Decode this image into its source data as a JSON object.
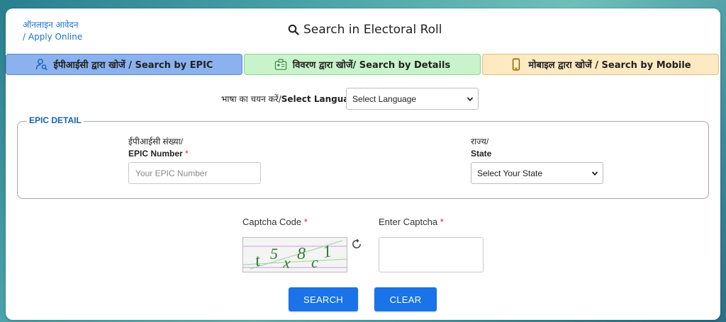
{
  "apply_online": {
    "line1": "ऑनलाइन आवेदन",
    "line2": "/ Apply Online"
  },
  "header": {
    "title": "Search in Electoral Roll"
  },
  "tabs": [
    {
      "label": "ईपीआईसी द्वारा खोजें / Search by EPIC",
      "icon": "user-search-icon",
      "color": "#8bb2ee"
    },
    {
      "label": "विवरण द्वारा खोजें/ Search by Details",
      "icon": "id-card-icon",
      "color": "#c9f3cb"
    },
    {
      "label": "मोबाइल द्वारा खोजें / Search by Mobile",
      "icon": "mobile-icon",
      "color": "#fde9c2"
    }
  ],
  "language": {
    "label_hi": "भाषा का चयन करें/",
    "label_en": "Select Language",
    "selected": "Select Language"
  },
  "epic_detail": {
    "legend": "EPIC DETAIL",
    "epic_label_hi": "ईपीआईसी संख्या/",
    "epic_label_en": "EPIC Number",
    "epic_placeholder": "Your EPIC Number",
    "state_label_hi": "राज्य/",
    "state_label_en": "State",
    "state_selected": "Select Your State"
  },
  "captcha": {
    "code_label": "Captcha Code",
    "enter_label": "Enter Captcha",
    "required_mark": "*",
    "image_text": "t5x8c1"
  },
  "buttons": {
    "search": "SEARCH",
    "clear": "CLEAR"
  },
  "colors": {
    "accent": "#1a73e8",
    "legend": "#1a5fb4",
    "link": "#1a73c9",
    "required": "#d32f2f"
  }
}
